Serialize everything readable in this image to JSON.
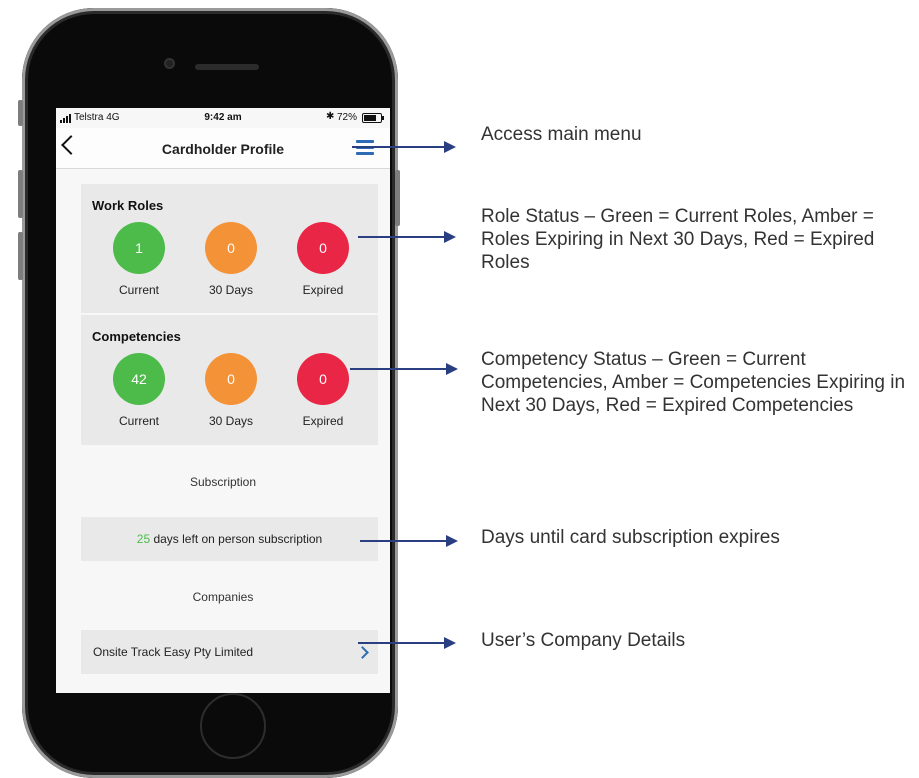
{
  "status_bar": {
    "carrier": "Telstra  4G",
    "time": "9:42 am",
    "bluetooth": "✱",
    "battery": "72%",
    "battery_level": 0.72
  },
  "nav": {
    "title": "Cardholder Profile",
    "back_icon": "chevron-left-icon",
    "menu_icon": "hamburger-menu-icon"
  },
  "work_roles": {
    "title": "Work Roles",
    "stats": [
      {
        "value": "1",
        "label": "Current",
        "color": "#4cbb49"
      },
      {
        "value": "0",
        "label": "30 Days",
        "color": "#f39237"
      },
      {
        "value": "0",
        "label": "Expired",
        "color": "#ea2646"
      }
    ]
  },
  "competencies": {
    "title": "Competencies",
    "stats": [
      {
        "value": "42",
        "label": "Current",
        "color": "#4cbb49"
      },
      {
        "value": "0",
        "label": "30 Days",
        "color": "#f39237"
      },
      {
        "value": "0",
        "label": "Expired",
        "color": "#ea2646"
      }
    ]
  },
  "subscription": {
    "header": "Subscription",
    "days": "25",
    "text": " days left on person subscription"
  },
  "companies": {
    "header": "Companies",
    "items": [
      {
        "name": "Onsite Track Easy Pty Limited"
      }
    ]
  },
  "annotations": [
    "Access main menu",
    "Role Status – Green = Current Roles, Amber = Roles Expiring in Next 30 Days, Red = Expired Roles",
    "Competency Status – Green = Current Competencies, Amber = Competencies Expiring in Next 30 Days, Red = Expired Competencies",
    "Days until card subscription expires",
    "User’s Company Details"
  ],
  "colors": {
    "accent": "#2e6bb3",
    "green": "#4cbb49",
    "amber": "#f39237",
    "red": "#ea2646",
    "arrow": "#2a3f82"
  }
}
